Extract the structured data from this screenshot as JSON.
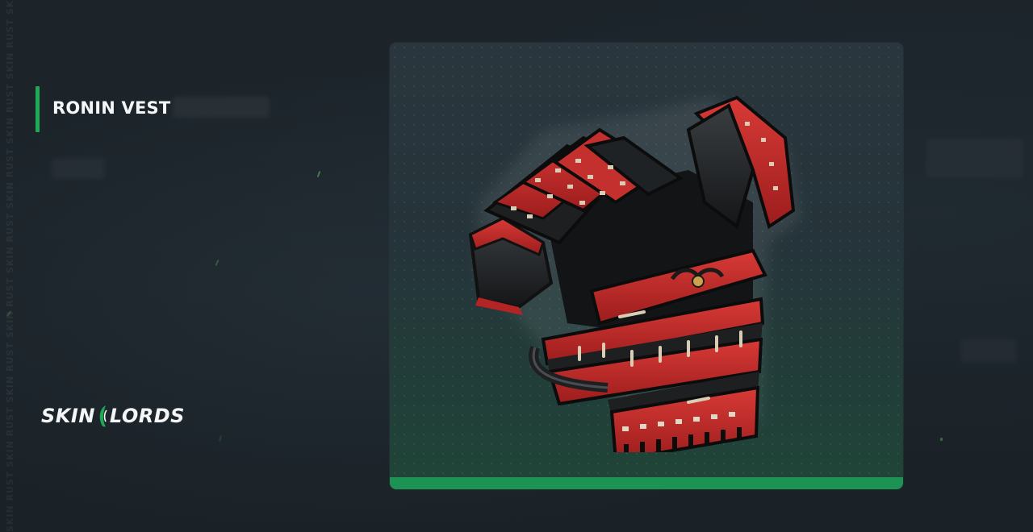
{
  "item": {
    "title": "RONIN VEST",
    "image_icon": "ronin-vest-armor-icon"
  },
  "brand": {
    "name_left": "SKIN",
    "name_right": "LORDS",
    "logo_icon": "skinlords-logo-icon",
    "accent_color": "#1fa955"
  },
  "watermark": {
    "text": "SKIN RUST SKIN RUST SKIN RUST SKIN RUST SKIN RUST SKIN RUST SKIN RUST SKIN RUST SKIN RUST"
  },
  "colors": {
    "background": "#1b2228",
    "card_top": "#2a363d",
    "card_bottom": "#1f4538",
    "card_bar": "#1c9353",
    "armor_red": "#c62a2a",
    "armor_dark": "#1b1d1f"
  }
}
